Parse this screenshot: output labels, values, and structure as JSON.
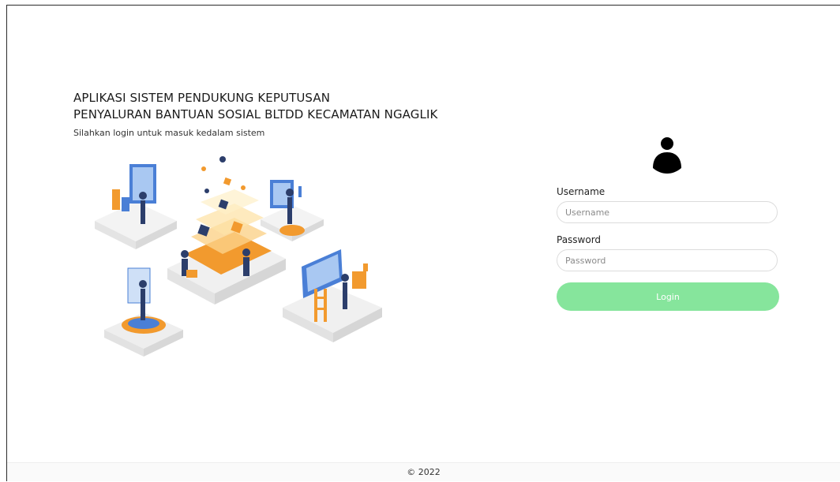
{
  "header": {
    "title_line1": "APLIKASI SISTEM PENDUKUNG KEPUTUSAN",
    "title_line2": "PENYALURAN BANTUAN SOSIAL BLTDD KECAMATAN NGAGLIK",
    "subtitle": "Silahkan login untuk masuk kedalam sistem"
  },
  "login_form": {
    "avatar_icon": "user-silhouette-icon",
    "username_label": "Username",
    "username_placeholder": "Username",
    "username_value": "",
    "password_label": "Password",
    "password_placeholder": "Password",
    "password_value": "",
    "submit_label": "Login"
  },
  "colors": {
    "accent_green": "#86e59c",
    "illustration_orange": "#f29a2e",
    "illustration_blue": "#4a7fd6",
    "text_dark": "#1b1b1b"
  },
  "footer": {
    "copyright": "© 2022"
  }
}
